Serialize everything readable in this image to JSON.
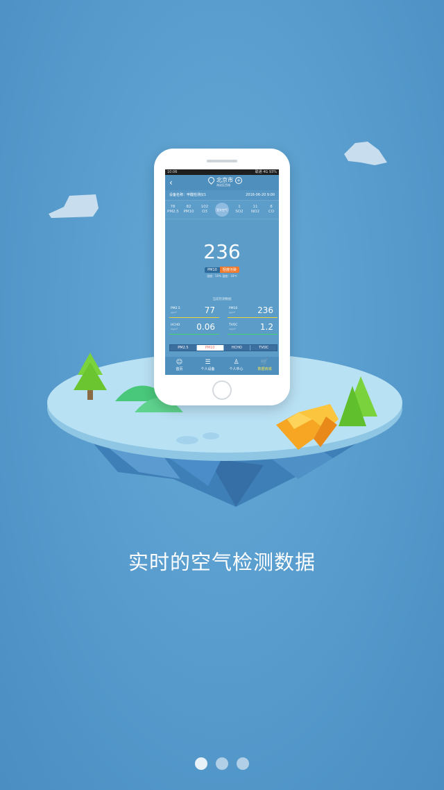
{
  "phone": {
    "status_left": "10:06",
    "status_right": "联通 4G 93%",
    "nav": {
      "city": "北京市",
      "city_sub": "海淀区西城"
    },
    "device": {
      "name": "设备名称：甲醛检测仪1",
      "time": "2016-06-20 9:00"
    },
    "pollutants": [
      {
        "value": "78",
        "label": "PM2.5"
      },
      {
        "value": "82",
        "label": "PM10"
      },
      {
        "value": "102",
        "label": "O3"
      },
      {
        "value": "室外空气",
        "label": ""
      },
      {
        "value": "1",
        "label": "SO2"
      },
      {
        "value": "11",
        "label": "NO2"
      },
      {
        "value": "8",
        "label": "CO"
      }
    ],
    "main_value": "236",
    "badge_pollutant": "PM10",
    "badge_level": "轻度污染",
    "humidity_temp": "湿度：50%  温度：18℃",
    "current_label": "当前检测数据",
    "metrics": [
      {
        "label": "PM2.5",
        "unit": "μg/m³",
        "value": "77",
        "color": "#f2d23a"
      },
      {
        "label": "PM10",
        "unit": "μg/m³",
        "value": "236",
        "color": "#f2d23a"
      },
      {
        "label": "HCHO",
        "unit": "mg/m³",
        "value": "0.06",
        "color": "#48d16b"
      },
      {
        "label": "TVOC",
        "unit": "mg/m³",
        "value": "1.2",
        "color": "#48d16b"
      }
    ],
    "tabs": [
      {
        "label": "PM2.5",
        "active": false
      },
      {
        "label": "PM10",
        "active": true
      },
      {
        "label": "HCHO",
        "active": false
      },
      {
        "label": "TVOC",
        "active": false
      }
    ],
    "bottom_nav": [
      {
        "label": "首页",
        "icon": "home-icon"
      },
      {
        "label": "个人设备",
        "icon": "list-icon"
      },
      {
        "label": "个人中心",
        "icon": "user-icon"
      },
      {
        "label": "数据商城",
        "icon": "cart-icon"
      }
    ]
  },
  "caption": "实时的空气检测数据",
  "pager": {
    "total": 3,
    "active": 1
  },
  "colors": {
    "background": "#5a9fcf",
    "island_top": "#b9e1f4",
    "accent": "#f6e64a"
  }
}
